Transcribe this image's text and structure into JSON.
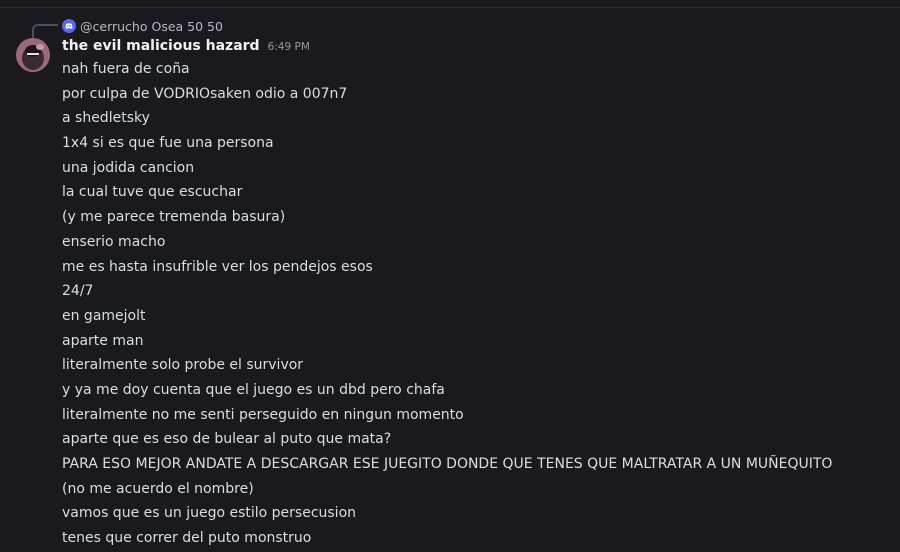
{
  "reply": {
    "author": "@cerrucho",
    "text": "Osea 50 50"
  },
  "message": {
    "username": "the evil malicious hazard",
    "timestamp": "6:49 PM",
    "lines": [
      "nah fuera de coña",
      "por culpa de VODRIOsaken odio a 007n7",
      "a shedletsky",
      "1x4 si es que fue una persona",
      "una jodida cancion",
      "la cual tuve que escuchar",
      "(y me parece tremenda basura)",
      "enserio macho",
      "me es hasta insufrible ver los pendejos esos",
      "24/7",
      "en gamejolt",
      "aparte man",
      "literalmente solo probe el survivor",
      "y ya me doy cuenta que el juego es un dbd pero chafa",
      "literalmente no me senti perseguido en ningun momento",
      "aparte que es eso de bulear al puto que mata?",
      "PARA ESO MEJOR ANDATE A DESCARGAR ESE JUEGITO DONDE QUE TENES QUE MALTRATAR A UN MUÑEQUITO",
      "(no me acuerdo el nombre)",
      "vamos que es un juego estilo persecusion",
      "tenes que correr del puto monstruo"
    ]
  },
  "colors": {
    "background": "#1a1a1e",
    "username": "#f2f3f5",
    "text": "#dbdee1",
    "muted": "#949ba4",
    "reply_avatar": "#5865f2"
  }
}
